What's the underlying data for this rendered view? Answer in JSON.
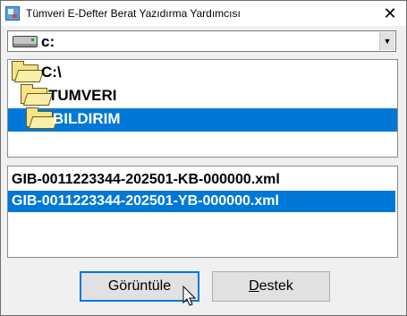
{
  "window": {
    "title": "Tümveri E-Defter Berat Yazıdırma Yardımcısı",
    "close_glyph": "✕"
  },
  "drive": {
    "value": "c:",
    "icon": "hard-drive-icon",
    "arrow": "▼"
  },
  "folders": [
    {
      "label": "C:\\",
      "icon": "open-folder-icon"
    },
    {
      "label": "TUMVERI",
      "icon": "open-folder-icon"
    },
    {
      "label": "BILDIRIM",
      "icon": "open-folder-icon",
      "selected": true
    }
  ],
  "files": [
    {
      "name": "GIB-0011223344-202501-KB-000000.xml"
    },
    {
      "name": "GIB-0011223344-202501-YB-000000.xml",
      "selected": true
    }
  ],
  "buttons": {
    "view_label": "Görüntüle",
    "help_underlined": "D",
    "help_rest": "estek"
  },
  "colors": {
    "selection": "#0078d7",
    "window_bg": "#f0f0f0"
  }
}
